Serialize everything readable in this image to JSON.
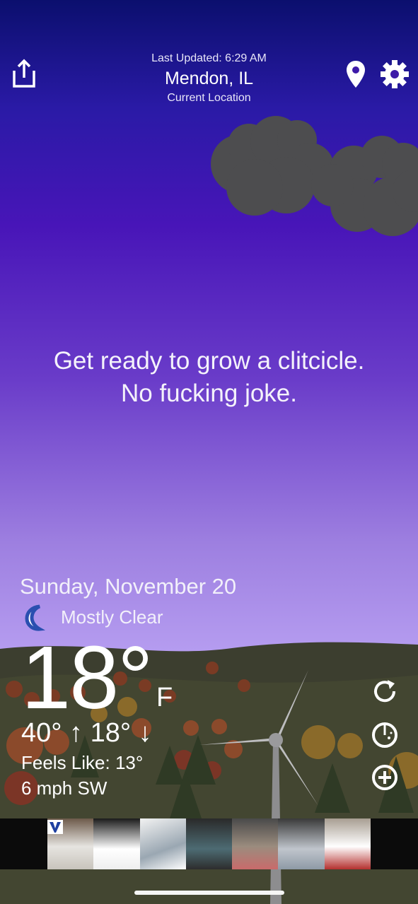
{
  "header": {
    "last_updated": "Last Updated: 6:29 AM",
    "city": "Mendon, IL",
    "location_label": "Current Location",
    "share_icon": "share-icon",
    "pin_icon": "location-pin-icon",
    "settings_icon": "gear-icon"
  },
  "message": {
    "line1": "Get ready to grow a clitcicle.",
    "line2": "No fucking joke."
  },
  "weather": {
    "date": "Sunday, November 20",
    "condition": "Mostly Clear",
    "condition_icon": "crescent-moon-icon",
    "temperature": "18°",
    "unit": "F",
    "high_low": "40° ↑  18° ↓",
    "feels_like": "Feels Like: 13°",
    "wind": "6 mph SW"
  },
  "actions": {
    "refresh_icon": "refresh-icon",
    "radar_icon": "radar-icon",
    "add_icon": "add-circle-icon"
  },
  "ad": {
    "logo_icon": "ad-logo-icon"
  },
  "colors": {
    "sky_top": "#0b0f6e",
    "sky_mid": "#4815b8",
    "sky_bottom": "#c0a6f6",
    "hill": "#3f4130",
    "cloud": "#4a4a4a"
  }
}
